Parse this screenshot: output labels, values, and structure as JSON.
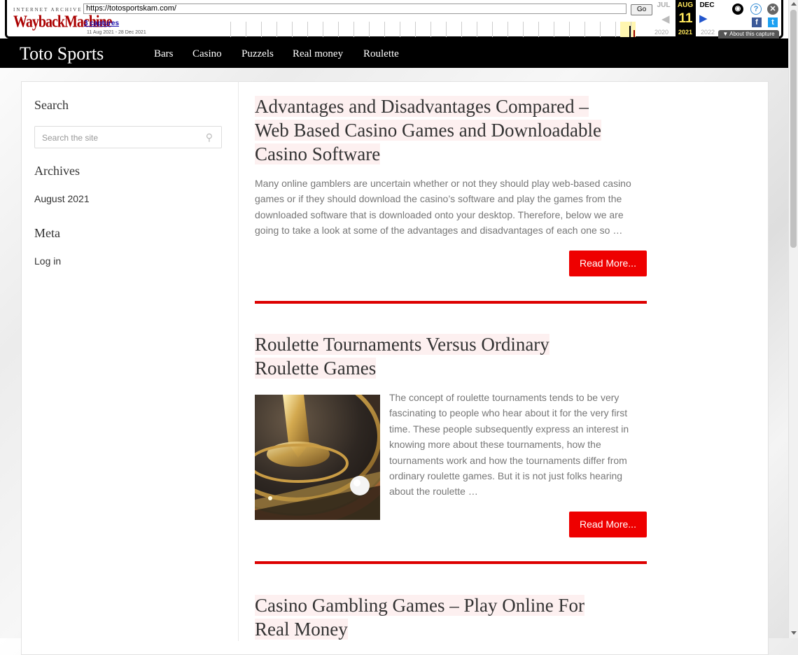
{
  "wayback": {
    "logo_top": "INTERNET ARCHIVE",
    "logo": "WaybackMachine",
    "url": "https://totosportskam.com/",
    "go_label": "Go",
    "captures_label": "3 captures",
    "date_range": "11 Aug 2021 - 28 Dec 2021",
    "prev_month": "JUL",
    "cur_month": "AUG",
    "next_month": "DEC",
    "cur_day": "11",
    "prev_year": "2020",
    "cur_year": "2021",
    "next_year": "2022",
    "about_label": "About this capture",
    "colors": {
      "highlight": "#ffe75b",
      "link": "#1a0dab"
    }
  },
  "header": {
    "site_title": "Toto Sports",
    "nav": [
      "Bars",
      "Casino",
      "Puzzels",
      "Real money",
      "Roulette"
    ]
  },
  "sidebar": {
    "search_title": "Search",
    "search_placeholder": "Search the site",
    "search_icon": "search-icon",
    "archives_title": "Archives",
    "archives": [
      "August 2021"
    ],
    "meta_title": "Meta",
    "meta": [
      "Log in"
    ]
  },
  "posts": [
    {
      "title_lines": [
        "Advantages and Disadvantages Compared –",
        "Web Based Casino Games and Downloadable",
        "Casino Software"
      ],
      "excerpt_lines": [
        "Many online gamblers are uncertain whether or not they should play web-based casino",
        "games or if they should download the casino’s software and play the games from the",
        "downloaded software that is downloaded onto your desktop. Therefore, below we are",
        "going to take a look at some of the advantages and disadvantages of each one so …"
      ],
      "read_more": "Read More..."
    },
    {
      "title_lines": [
        "Roulette Tournaments Versus Ordinary",
        "Roulette Games"
      ],
      "excerpt_lines": [
        "The concept of roulette tournaments tends to be very",
        "fascinating to people who hear about it for the very first",
        "time. These people subsequently express an interest in",
        "knowing more about these tournaments, how the",
        "tournaments work and how the tournaments differ from",
        "ordinary roulette games. But it is not just folks hearing",
        "about the roulette …"
      ],
      "read_more": "Read More..."
    },
    {
      "title_lines": [
        "Casino Gambling Games – Play Online For",
        "Real Money"
      ]
    }
  ],
  "colors": {
    "accent": "#ee0000",
    "header_bg": "#000000"
  }
}
